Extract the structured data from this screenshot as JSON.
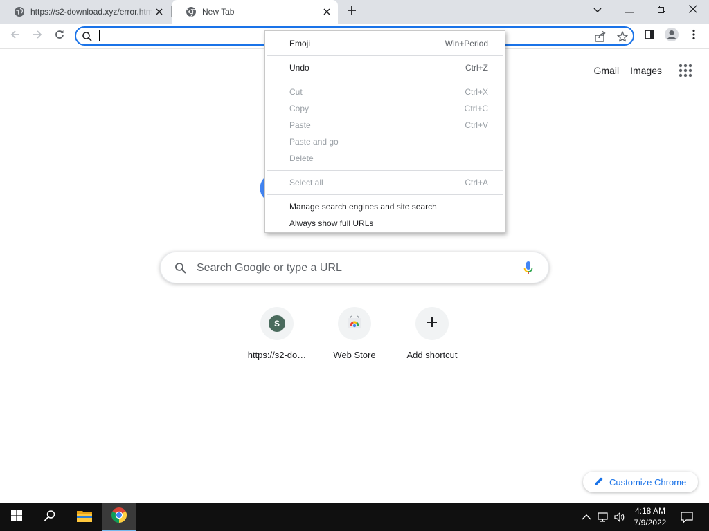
{
  "tabs": [
    {
      "title": "https://s2-download.xyz/error.html",
      "icon": "globe-icon"
    },
    {
      "title": "New Tab",
      "icon": "chrome-icon"
    }
  ],
  "ntp": {
    "links": {
      "gmail": "Gmail",
      "images": "Images"
    },
    "search_placeholder": "Search Google or type a URL",
    "shortcuts": [
      {
        "label": "https://s2-do…",
        "letter": "S"
      },
      {
        "label": "Web Store"
      },
      {
        "label": "Add shortcut"
      }
    ],
    "customize_label": "Customize Chrome"
  },
  "context_menu": {
    "items": [
      {
        "label": "Emoji",
        "shortcut": "Win+Period",
        "disabled": false
      },
      {
        "separator": true
      },
      {
        "label": "Undo",
        "shortcut": "Ctrl+Z",
        "disabled": false
      },
      {
        "separator": true
      },
      {
        "label": "Cut",
        "shortcut": "Ctrl+X",
        "disabled": true
      },
      {
        "label": "Copy",
        "shortcut": "Ctrl+C",
        "disabled": true
      },
      {
        "label": "Paste",
        "shortcut": "Ctrl+V",
        "disabled": true
      },
      {
        "label": "Paste and go",
        "shortcut": "",
        "disabled": true
      },
      {
        "label": "Delete",
        "shortcut": "",
        "disabled": true
      },
      {
        "separator": true
      },
      {
        "label": "Select all",
        "shortcut": "Ctrl+A",
        "disabled": true
      },
      {
        "separator": true
      },
      {
        "label": "Manage search engines and site search",
        "shortcut": "",
        "disabled": false
      },
      {
        "label": "Always show full URLs",
        "shortcut": "",
        "disabled": false
      }
    ]
  },
  "taskbar": {
    "time": "4:18 AM",
    "date": "7/9/2022"
  },
  "colors": {
    "accent": "#1a73e8",
    "tabstrip": "#dee1e6",
    "taskbar": "#101010"
  }
}
